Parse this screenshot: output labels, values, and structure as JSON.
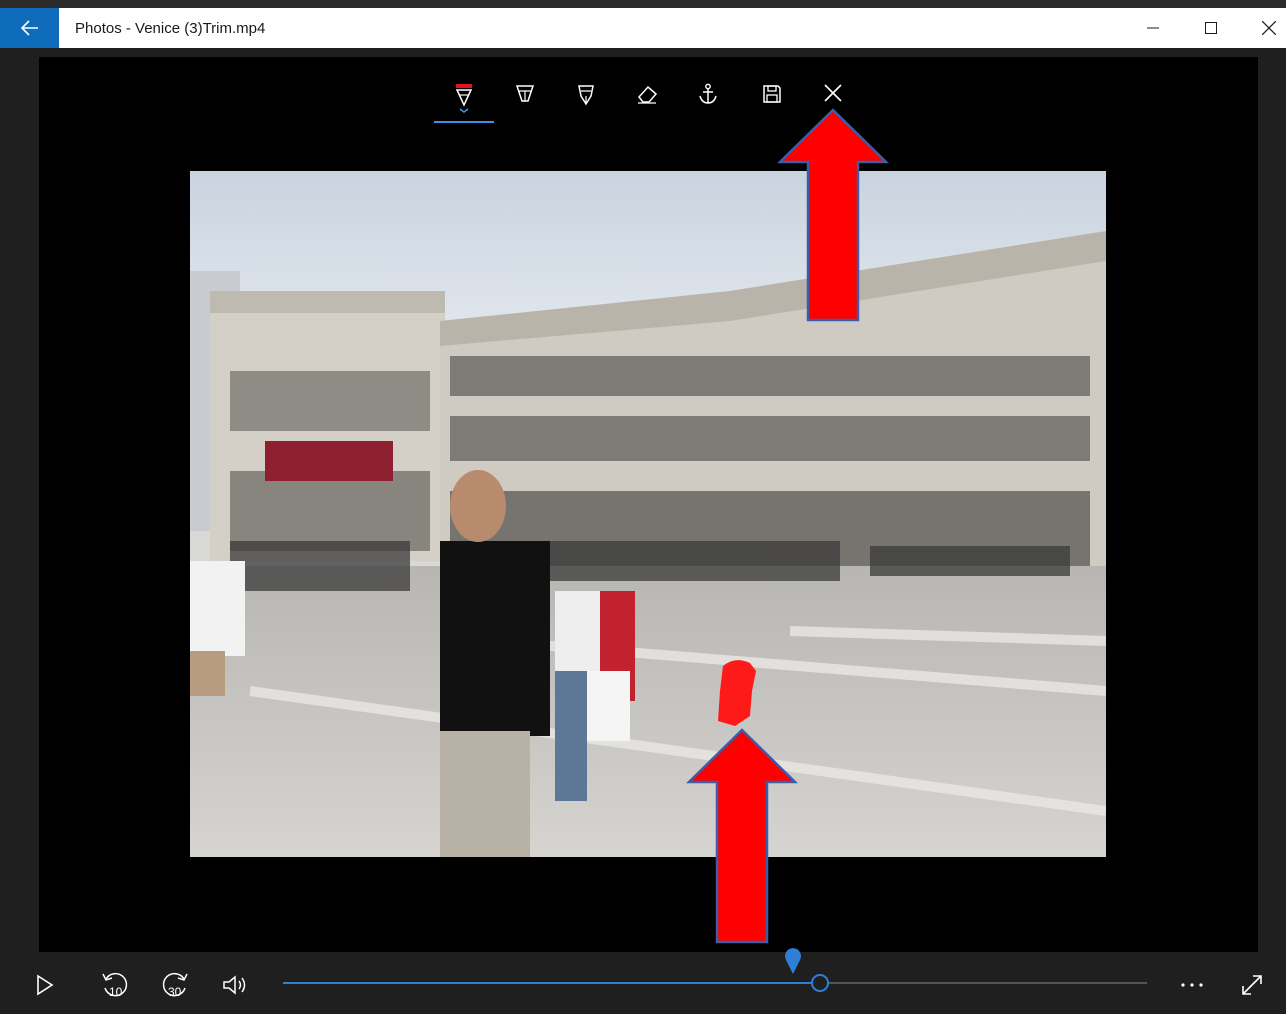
{
  "window": {
    "title": "Photos - Venice (3)Trim.mp4",
    "back_icon": "back-arrow-icon",
    "minimize_icon": "minimize-icon",
    "maximize_icon": "maximize-icon",
    "close_icon": "close-icon"
  },
  "ink_toolbar": {
    "tools": [
      {
        "name": "ballpoint-pen",
        "icon": "ballpoint-pen-icon",
        "active": true,
        "color": "#e81123"
      },
      {
        "name": "calligraphy-pen",
        "icon": "calligraphy-pen-icon",
        "active": false
      },
      {
        "name": "pencil",
        "icon": "pencil-icon",
        "active": false
      },
      {
        "name": "eraser",
        "icon": "eraser-icon",
        "active": false
      },
      {
        "name": "anchor",
        "icon": "anchor-icon",
        "active": false
      },
      {
        "name": "save",
        "icon": "save-icon",
        "active": false
      },
      {
        "name": "close",
        "icon": "close-icon",
        "active": false
      }
    ]
  },
  "video": {
    "description_icon": "video-frame"
  },
  "annotations": {
    "arrow_color": "#ff0000",
    "ink_stroke_color": "#ff0000"
  },
  "playback": {
    "play_icon": "play-icon",
    "rewind_label": "10",
    "forward_label": "30",
    "volume_icon": "volume-icon",
    "more_icon": "more-icon",
    "fullscreen_icon": "fullscreen-icon",
    "progress": 0.621,
    "ink_marker_position": 0.59,
    "accent_color": "#2f7fd6"
  }
}
